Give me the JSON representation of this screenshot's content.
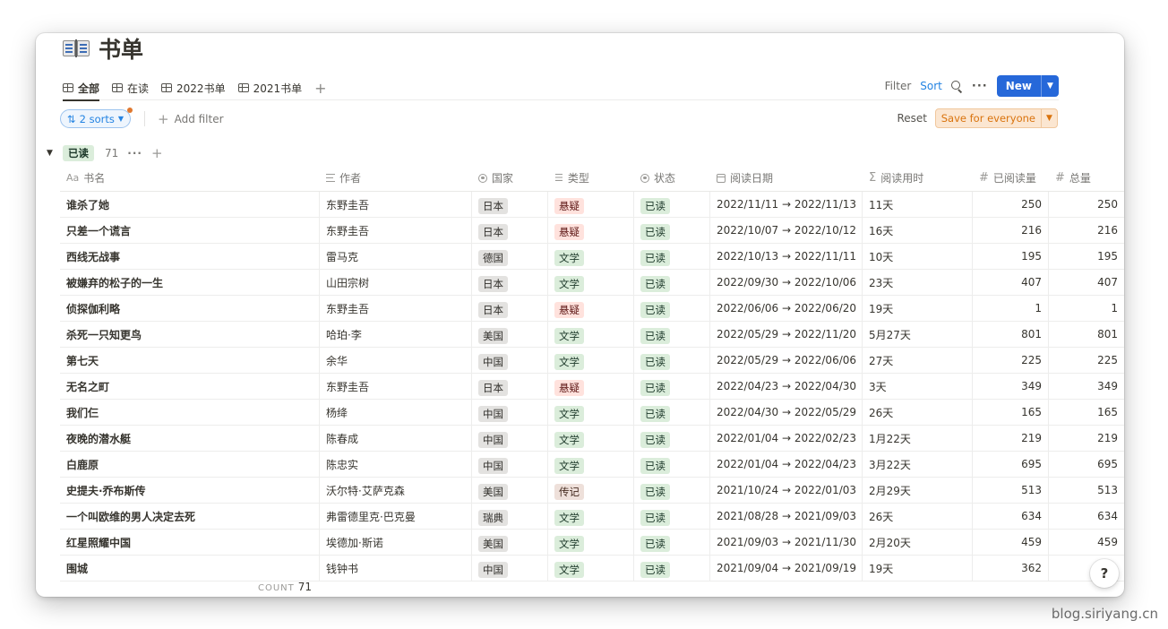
{
  "page": {
    "title": "书单"
  },
  "tabs": [
    {
      "label": "全部",
      "active": true
    },
    {
      "label": "在读"
    },
    {
      "label": "2022书单"
    },
    {
      "label": "2021书单"
    }
  ],
  "toolbar": {
    "filter": "Filter",
    "sort": "Sort",
    "new_label": "New"
  },
  "sorts": {
    "label": "2 sorts",
    "add_filter": "Add filter",
    "reset": "Reset",
    "save": "Save for everyone"
  },
  "group": {
    "label": "已读",
    "count": "71"
  },
  "columns": [
    {
      "icon": "Aa",
      "label": "书名"
    },
    {
      "icon": "lines",
      "label": "作者"
    },
    {
      "icon": "circ",
      "label": "国家"
    },
    {
      "icon": "list",
      "label": "类型"
    },
    {
      "icon": "circ",
      "label": "状态"
    },
    {
      "icon": "cal",
      "label": "阅读日期"
    },
    {
      "icon": "Σ",
      "label": "阅读用时"
    },
    {
      "icon": "#",
      "label": "已阅读量"
    },
    {
      "icon": "#",
      "label": "总量"
    }
  ],
  "rows": [
    {
      "title": "谁杀了她",
      "author": "东野圭吾",
      "country": "日本",
      "genre": "悬疑",
      "genre_color": "red",
      "status": "已读",
      "date": "2022/11/11 → 2022/11/13",
      "duration": "11天",
      "read": "250",
      "total": "250"
    },
    {
      "title": "只差一个谎言",
      "author": "东野圭吾",
      "country": "日本",
      "genre": "悬疑",
      "genre_color": "red",
      "status": "已读",
      "date": "2022/10/07 → 2022/10/12",
      "duration": "16天",
      "read": "216",
      "total": "216"
    },
    {
      "title": "西线无战事",
      "author": "雷马克",
      "country": "德国",
      "genre": "文学",
      "genre_color": "green",
      "status": "已读",
      "date": "2022/10/13 → 2022/11/11",
      "duration": "10天",
      "read": "195",
      "total": "195"
    },
    {
      "title": "被嫌弃的松子的一生",
      "author": "山田宗树",
      "country": "日本",
      "genre": "文学",
      "genre_color": "green",
      "status": "已读",
      "date": "2022/09/30 → 2022/10/06",
      "duration": "23天",
      "read": "407",
      "total": "407"
    },
    {
      "title": "侦探伽利略",
      "author": "东野圭吾",
      "country": "日本",
      "genre": "悬疑",
      "genre_color": "red",
      "status": "已读",
      "date": "2022/06/06 → 2022/06/20",
      "duration": "19天",
      "read": "1",
      "total": "1"
    },
    {
      "title": "杀死一只知更鸟",
      "author": "哈珀·李",
      "country": "美国",
      "genre": "文学",
      "genre_color": "green",
      "status": "已读",
      "date": "2022/05/29 → 2022/11/20",
      "duration": "5月27天",
      "read": "801",
      "total": "801"
    },
    {
      "title": "第七天",
      "author": "余华",
      "country": "中国",
      "genre": "文学",
      "genre_color": "green",
      "status": "已读",
      "date": "2022/05/29 → 2022/06/06",
      "duration": "27天",
      "read": "225",
      "total": "225"
    },
    {
      "title": "无名之町",
      "author": "东野圭吾",
      "country": "日本",
      "genre": "悬疑",
      "genre_color": "red",
      "status": "已读",
      "date": "2022/04/23 → 2022/04/30",
      "duration": "3天",
      "read": "349",
      "total": "349"
    },
    {
      "title": "我们仨",
      "author": "杨绛",
      "country": "中国",
      "genre": "文学",
      "genre_color": "green",
      "status": "已读",
      "date": "2022/04/30 → 2022/05/29",
      "duration": "26天",
      "read": "165",
      "total": "165"
    },
    {
      "title": "夜晚的潜水艇",
      "author": "陈春成",
      "country": "中国",
      "genre": "文学",
      "genre_color": "green",
      "status": "已读",
      "date": "2022/01/04 → 2022/02/23",
      "duration": "1月22天",
      "read": "219",
      "total": "219"
    },
    {
      "title": "白鹿原",
      "author": "陈忠实",
      "country": "中国",
      "genre": "文学",
      "genre_color": "green",
      "status": "已读",
      "date": "2022/01/04 → 2022/04/23",
      "duration": "3月22天",
      "read": "695",
      "total": "695"
    },
    {
      "title": "史提夫·乔布斯传",
      "author": "沃尔特·艾萨克森",
      "country": "美国",
      "genre": "传记",
      "genre_color": "brown",
      "status": "已读",
      "date": "2021/10/24 → 2022/01/03",
      "duration": "2月29天",
      "read": "513",
      "total": "513"
    },
    {
      "title": "一个叫欧维的男人决定去死",
      "author": "弗雷德里克·巴克曼",
      "country": "瑞典",
      "genre": "文学",
      "genre_color": "green",
      "status": "已读",
      "date": "2021/08/28 → 2021/09/03",
      "duration": "26天",
      "read": "634",
      "total": "634"
    },
    {
      "title": "红星照耀中国",
      "author": "埃德加·斯诺",
      "country": "美国",
      "genre": "文学",
      "genre_color": "green",
      "status": "已读",
      "date": "2021/09/03 → 2021/11/30",
      "duration": "2月20天",
      "read": "459",
      "total": "459"
    },
    {
      "title": "围城",
      "author": "钱钟书",
      "country": "中国",
      "genre": "文学",
      "genre_color": "green",
      "status": "已读",
      "date": "2021/09/04 → 2021/09/19",
      "duration": "19天",
      "read": "362",
      "total": ""
    }
  ],
  "footer": {
    "count_label": "COUNT",
    "count_value": "71"
  },
  "help": "?",
  "watermark": "blog.siriyang.cn",
  "colors": {
    "accent": "#2668d9",
    "sort_blue": "#2383e2",
    "save_orange": "#d9730d"
  }
}
